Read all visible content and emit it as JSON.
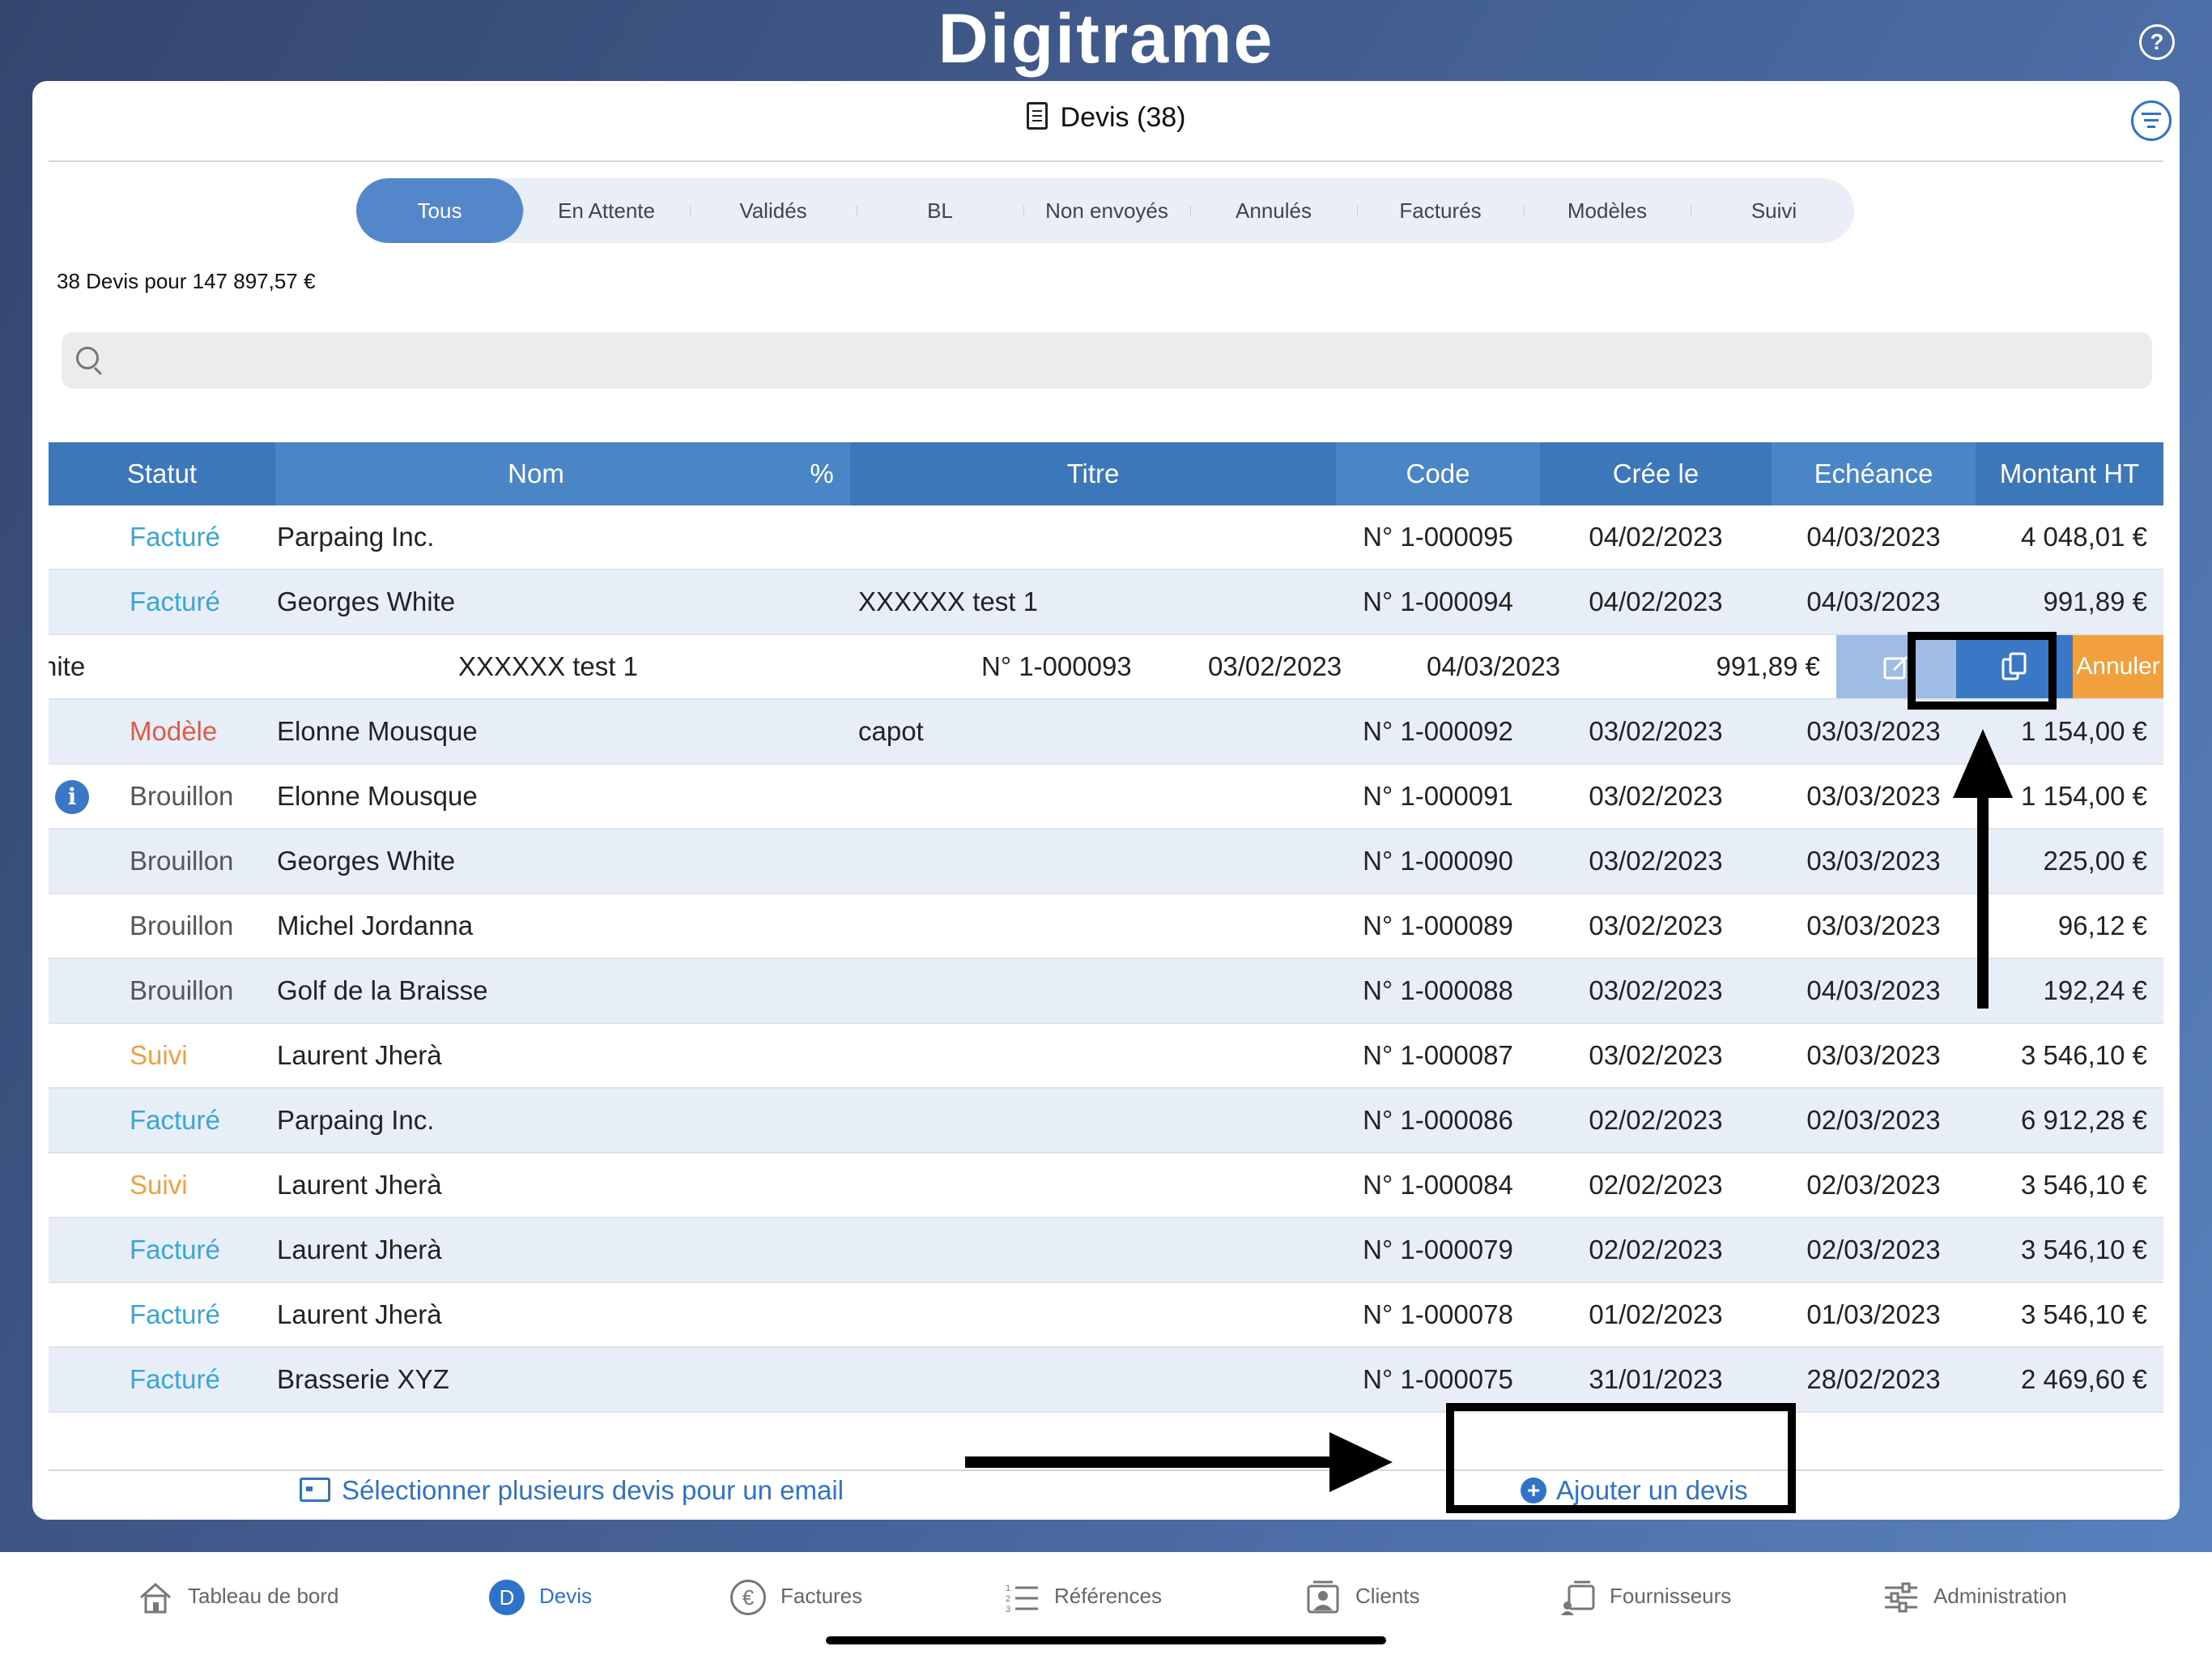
{
  "app": {
    "title": "Digitrame",
    "help_label": "?"
  },
  "header": {
    "title": "Devis (38)"
  },
  "segments": [
    "Tous",
    "En Attente",
    "Validés",
    "BL",
    "Non envoyés",
    "Annulés",
    "Facturés",
    "Modèles",
    "Suivi"
  ],
  "active_segment": "Tous",
  "summary": "38 Devis pour 147 897,57 €",
  "search": {
    "placeholder": ""
  },
  "table": {
    "columns": [
      "Statut",
      "Nom",
      "%",
      "Titre",
      "Code",
      "Crée le",
      "Echéance",
      "Montant HT"
    ],
    "rows": [
      {
        "statut": "Facturé",
        "nom": "Parpaing Inc.",
        "titre": "",
        "code": "N° 1-000095",
        "cree": "04/02/2023",
        "echeance": "04/03/2023",
        "montant": "4 048,01 €"
      },
      {
        "statut": "Facturé",
        "nom": "Georges White",
        "titre": "XXXXXX test 1",
        "code": "N° 1-000094",
        "cree": "04/02/2023",
        "echeance": "04/03/2023",
        "montant": "991,89 €"
      },
      {
        "statut": "",
        "nom": "hite",
        "titre": "XXXXXX test 1",
        "code": "N° 1-000093",
        "cree": "03/02/2023",
        "echeance": "04/03/2023",
        "montant": "991,89 €"
      },
      {
        "statut": "Modèle",
        "nom": "Elonne Mousque",
        "titre": "capot",
        "code": "N° 1-000092",
        "cree": "03/02/2023",
        "echeance": "03/03/2023",
        "montant": "1 154,00 €"
      },
      {
        "statut": "Brouillon",
        "nom": "Elonne Mousque",
        "titre": "",
        "code": "N° 1-000091",
        "cree": "03/02/2023",
        "echeance": "03/03/2023",
        "montant": "1 154,00 €"
      },
      {
        "statut": "Brouillon",
        "nom": "Georges White",
        "titre": "",
        "code": "N° 1-000090",
        "cree": "03/02/2023",
        "echeance": "03/03/2023",
        "montant": "225,00 €"
      },
      {
        "statut": "Brouillon",
        "nom": "Michel Jordanna",
        "titre": "",
        "code": "N° 1-000089",
        "cree": "03/02/2023",
        "echeance": "03/03/2023",
        "montant": "96,12 €"
      },
      {
        "statut": "Brouillon",
        "nom": "Golf de la Braisse",
        "titre": "",
        "code": "N° 1-000088",
        "cree": "03/02/2023",
        "echeance": "04/03/2023",
        "montant": "192,24 €"
      },
      {
        "statut": "Suivi",
        "nom": "Laurent Jherà",
        "titre": "",
        "code": "N° 1-000087",
        "cree": "03/02/2023",
        "echeance": "03/03/2023",
        "montant": "3 546,10 €"
      },
      {
        "statut": "Facturé",
        "nom": "Parpaing Inc.",
        "titre": "",
        "code": "N° 1-000086",
        "cree": "02/02/2023",
        "echeance": "02/03/2023",
        "montant": "6 912,28 €"
      },
      {
        "statut": "Suivi",
        "nom": "Laurent Jherà",
        "titre": "",
        "code": "N° 1-000084",
        "cree": "02/02/2023",
        "echeance": "02/03/2023",
        "montant": "3 546,10 €"
      },
      {
        "statut": "Facturé",
        "nom": "Laurent Jherà",
        "titre": "",
        "code": "N° 1-000079",
        "cree": "02/02/2023",
        "echeance": "02/03/2023",
        "montant": "3 546,10 €"
      },
      {
        "statut": "Facturé",
        "nom": "Laurent Jherà",
        "titre": "",
        "code": "N° 1-000078",
        "cree": "01/02/2023",
        "echeance": "01/03/2023",
        "montant": "3 546,10 €"
      },
      {
        "statut": "Facturé",
        "nom": "Brasserie XYZ",
        "titre": "",
        "code": "N° 1-000075",
        "cree": "31/01/2023",
        "echeance": "28/02/2023",
        "montant": "2 469,60 €"
      }
    ]
  },
  "swipe_actions": {
    "edit_icon": "edit-icon",
    "duplicate_icon": "duplicate-icon",
    "cancel_label": "Annuler"
  },
  "footer": {
    "select_email": "Sélectionner plusieurs devis pour un email",
    "add_quote": "Ajouter un devis",
    "add_icon": "+"
  },
  "tabbar": [
    {
      "label": "Tableau de bord",
      "icon": "home-icon"
    },
    {
      "label": "Devis",
      "icon": "devis-icon",
      "badge": "D"
    },
    {
      "label": "Factures",
      "icon": "euro-icon",
      "badge": "€"
    },
    {
      "label": "Références",
      "icon": "list-icon"
    },
    {
      "label": "Clients",
      "icon": "clients-icon"
    },
    {
      "label": "Fournisseurs",
      "icon": "suppliers-icon"
    },
    {
      "label": "Administration",
      "icon": "sliders-icon"
    }
  ],
  "colors": {
    "accent": "#2f73c8",
    "header_blue": "#4a86c6",
    "facture": "#35a7d9",
    "modele": "#e05a47",
    "suivi": "#f2a03d",
    "cancel": "#f2a03d"
  }
}
